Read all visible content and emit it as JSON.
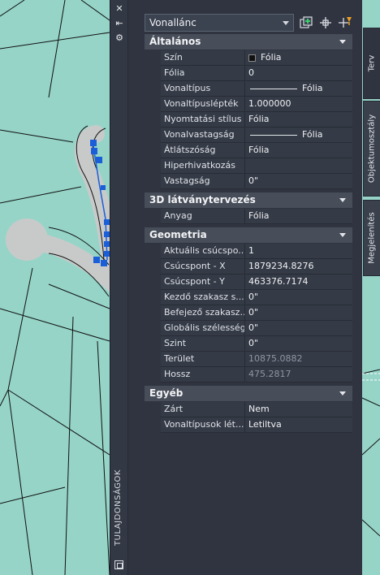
{
  "palette": {
    "title": "TULAJDONSÁGOK",
    "object_type": "Vonallánc",
    "sections": [
      {
        "title": "Általános",
        "rows": [
          {
            "label": "Szín",
            "value": "Fólia",
            "kind": "color"
          },
          {
            "label": "Fólia",
            "value": "0"
          },
          {
            "label": "Vonaltípus",
            "value": "Fólia",
            "kind": "line"
          },
          {
            "label": "Vonaltípuslépték",
            "value": "1.000000"
          },
          {
            "label": "Nyomtatási stílus",
            "value": "Fólia"
          },
          {
            "label": "Vonalvastagság",
            "value": "Fólia",
            "kind": "line"
          },
          {
            "label": "Átlátszóság",
            "value": "Fólia"
          },
          {
            "label": "Hiperhivatkozás",
            "value": ""
          },
          {
            "label": "Vastagság",
            "value": "0\""
          }
        ]
      },
      {
        "title": "3D látványtervezés",
        "rows": [
          {
            "label": "Anyag",
            "value": "Fólia"
          }
        ]
      },
      {
        "title": "Geometria",
        "rows": [
          {
            "label": "Aktuális csúcspo...",
            "value": "1"
          },
          {
            "label": "Csúcspont - X",
            "value": "1879234.8276"
          },
          {
            "label": "Csúcspont - Y",
            "value": "463376.7174"
          },
          {
            "label": "Kezdő szakasz s...",
            "value": "0\""
          },
          {
            "label": "Befejező szakasz...",
            "value": "0\""
          },
          {
            "label": "Globális szélesség",
            "value": "0\""
          },
          {
            "label": "Szint",
            "value": "0\""
          },
          {
            "label": "Terület",
            "value": "10875.0882",
            "readonly": true
          },
          {
            "label": "Hossz",
            "value": "475.2817",
            "readonly": true
          }
        ]
      },
      {
        "title": "Egyéb",
        "rows": [
          {
            "label": "Zárt",
            "value": "Nem"
          },
          {
            "label": "Vonaltípusok lét...",
            "value": "Letiltva"
          }
        ]
      }
    ],
    "tabs": [
      "Terv",
      "Objektumosztály",
      "Megjelenítés"
    ]
  },
  "colors": {
    "canvas": "#96d4c8",
    "panel": "#2f3440",
    "section_header": "#474d59",
    "selection": "#1a5fd8"
  },
  "icons": {
    "close": "close-icon",
    "autohide": "autohide-icon",
    "settings": "settings-icon",
    "quick_select": "quick-select-icon",
    "select_objects": "select-objects-icon",
    "pickadd": "toggle-pickadd-icon"
  }
}
